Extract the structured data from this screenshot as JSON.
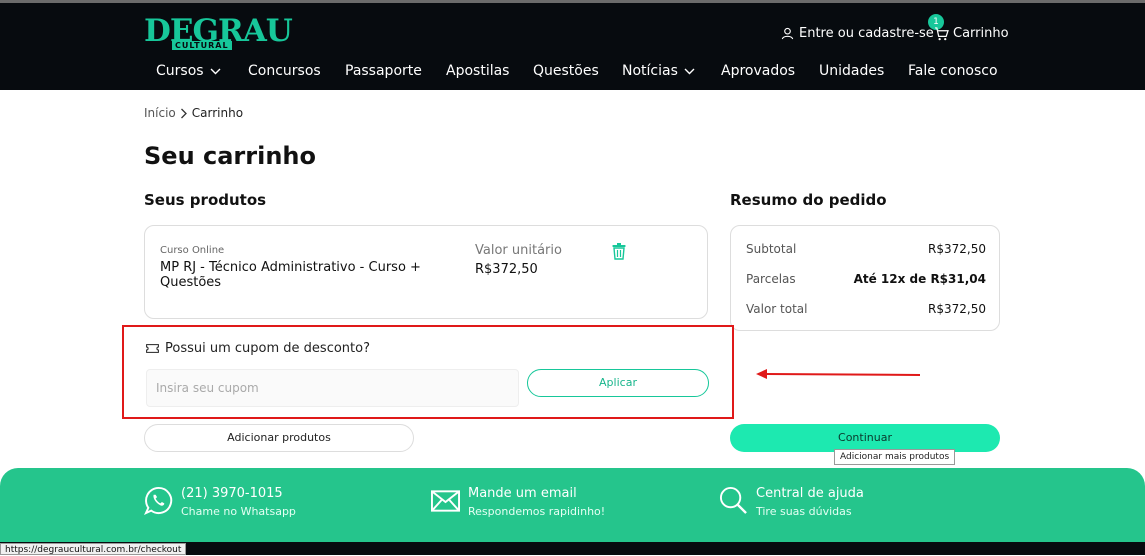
{
  "header": {
    "logo_main": "DEGRAU",
    "logo_sub": "CULTURAL",
    "account_label": "Entre ou cadastre-se",
    "cart_label": "Carrinho",
    "cart_count": "1",
    "nav": [
      {
        "label": "Cursos",
        "dropdown": true
      },
      {
        "label": "Concursos"
      },
      {
        "label": "Passaporte"
      },
      {
        "label": "Apostilas"
      },
      {
        "label": "Questões"
      },
      {
        "label": "Notícias",
        "dropdown": true
      },
      {
        "label": "Aprovados"
      },
      {
        "label": "Unidades"
      },
      {
        "label": "Fale conosco"
      }
    ]
  },
  "breadcrumb": {
    "home": "Início",
    "current": "Carrinho"
  },
  "page_title": "Seu carrinho",
  "products": {
    "heading": "Seus produtos",
    "items": [
      {
        "kind": "Curso Online",
        "name": "MP RJ - Técnico Administrativo - Curso + Questões",
        "unit_label": "Valor unitário",
        "unit_price": "R$372,50"
      }
    ]
  },
  "summary": {
    "heading": "Resumo do pedido",
    "subtotal_label": "Subtotal",
    "subtotal": "R$372,50",
    "parcelas_label": "Parcelas",
    "parcelas": "Até 12x de R$31,04",
    "total_label": "Valor total",
    "total": "R$372,50"
  },
  "coupon": {
    "question": "Possui um cupom de desconto?",
    "placeholder": "Insira seu cupom",
    "apply_label": "Aplicar"
  },
  "actions": {
    "add_label": "Adicionar produtos",
    "continue_label": "Continuar",
    "tooltip": "Adicionar mais produtos"
  },
  "footer": {
    "phone": "(21) 3970-1015",
    "phone_sub": "Chame no Whatsapp",
    "email": "Mande um email",
    "email_sub": "Respondemos rapidinho!",
    "help": "Central de ajuda",
    "help_sub": "Tire suas dúvidas"
  },
  "status_url": "https://degraucultural.com.br/checkout",
  "colors": {
    "accent": "#17c79a",
    "header_bg": "#070b0f",
    "footer_bg": "#25c58c",
    "highlight": "#e01919",
    "continue_bg": "#1de9b0"
  }
}
